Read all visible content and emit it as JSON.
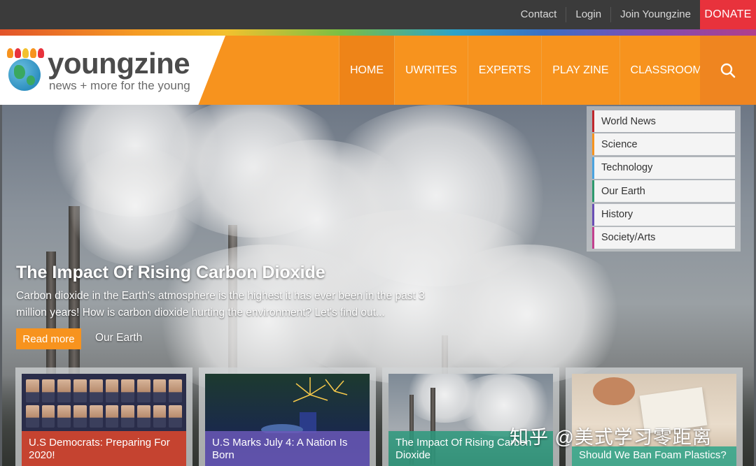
{
  "topbar": {
    "links": [
      "Contact",
      "Login",
      "Join Youngzine"
    ],
    "donate_label": "DONATE"
  },
  "brand": {
    "name": "youngzine",
    "tagline": "news + more for the young"
  },
  "nav": {
    "items": [
      "HOME",
      "UWRITES",
      "EXPERTS",
      "PLAY ZINE",
      "CLASSROOM"
    ],
    "search_icon": "search-icon"
  },
  "hero": {
    "title": "The Impact Of Rising Carbon Dioxide",
    "summary": "Carbon dioxide in the Earth's atmosphere is the highest it has ever been in the past 3 million years! How is carbon dioxide hurting the environment? Let's find out...",
    "read_more_label": "Read more",
    "category": "Our Earth"
  },
  "categories": [
    {
      "label": "World News",
      "color": "#c0272d"
    },
    {
      "label": "Science",
      "color": "#f7931e"
    },
    {
      "label": "Technology",
      "color": "#4aa3df"
    },
    {
      "label": "Our Earth",
      "color": "#2e9a6e"
    },
    {
      "label": "History",
      "color": "#6a4fb5"
    },
    {
      "label": "Society/Arts",
      "color": "#c2418f"
    }
  ],
  "cards": [
    {
      "title": "U.S Democrats: Preparing For 2020!",
      "caption_color": "#e0482c"
    },
    {
      "title": "U.S Marks July 4: A Nation Is Born",
      "caption_color": "#6a58b8"
    },
    {
      "title": "The Impact Of Rising Carbon Dioxide",
      "caption_color": "#2e9a7e"
    },
    {
      "title": "Should We Ban Foam Plastics?",
      "caption_color": "#2ea58a"
    }
  ],
  "watermark": "知乎 @美式学习零距离"
}
